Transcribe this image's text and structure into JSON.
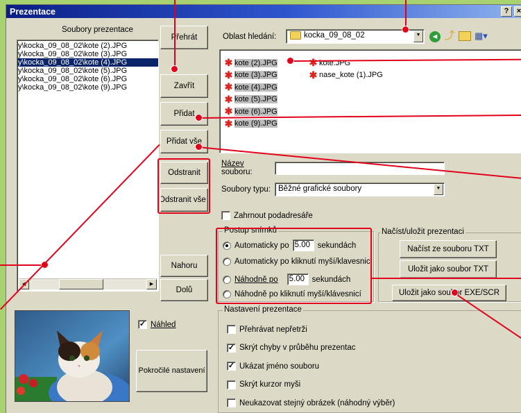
{
  "window": {
    "title": "Prezentace",
    "help_btn": "?",
    "close_btn": "×"
  },
  "left": {
    "header": "Soubory prezentace",
    "files": [
      "y\\kocka_09_08_02\\kote (2).JPG",
      "y\\kocka_09_08_02\\kote (3).JPG",
      "y\\kocka_09_08_02\\kote (4).JPG",
      "y\\kocka_09_08_02\\kote (5).JPG",
      "y\\kocka_09_08_02\\kote (6).JPG",
      "y\\kocka_09_08_02\\kote (9).JPG"
    ],
    "selected_index": 2
  },
  "buttons": {
    "play": "Přehrát",
    "close": "Zavřít",
    "add": "Přidat",
    "add_all": "Přidat vše",
    "remove": "Odstranit",
    "remove_all": "Odstranit vše",
    "up": "Nahoru",
    "down": "Dolů",
    "advanced": "Pokročilé nastavení"
  },
  "preview": {
    "label": "Náhled",
    "checked": true
  },
  "browser": {
    "area_label": "Oblast hledání:",
    "folder": "kocka_09_08_02",
    "files_col1": [
      "kote (2).JPG",
      "kote (3).JPG",
      "kote (4).JPG",
      "kote (5).JPG",
      "kote (6).JPG",
      "kote (9).JPG"
    ],
    "files_col2": [
      "kote.JPG",
      "nase_kote (1).JPG"
    ],
    "filename_label_1": "Název",
    "filename_label_2": "souboru:",
    "filename_value": "",
    "filetype_label": "Soubory typu:",
    "filetype_value": "Běžné grafické soubory",
    "subfolders_label": "Zahrnout podadresáře",
    "subfolders_checked": false
  },
  "sequence": {
    "title": "Postup snímků",
    "opt1_a": "Automaticky po",
    "opt1_val": "5.00",
    "opt1_b": "sekundách",
    "opt2": "Automaticky po kliknutí myší/klavesnic",
    "opt3_a": "Náhodně po",
    "opt3_val": "5.00",
    "opt3_b": "sekundách",
    "opt4": "Náhodně po kliknutí myší/klávesnicí",
    "selected": 1
  },
  "loadsave": {
    "title": "Načíst/uložit prezentaci",
    "load_txt": "Načíst ze souboru TXT",
    "save_txt": "Uložit jako soubor  TXT",
    "save_exe": "Uložit jako soubor EXE/SCR"
  },
  "settings": {
    "title": "Nastavení prezentace",
    "items": [
      {
        "label": "Přehrávat nepřetrži",
        "checked": false
      },
      {
        "label": "Skrýt chyby v průběhu prezentac",
        "checked": true
      },
      {
        "label": "Ukázat jméno souboru",
        "checked": true
      },
      {
        "label": "Skrýt kurzor myši",
        "checked": false
      },
      {
        "label": "Neukazovat stejný obrázek (náhodný výběr)",
        "checked": false
      }
    ]
  },
  "colors": {
    "callout": "#e2001a",
    "selection": "#0a246a",
    "background": "#a7d26f"
  }
}
